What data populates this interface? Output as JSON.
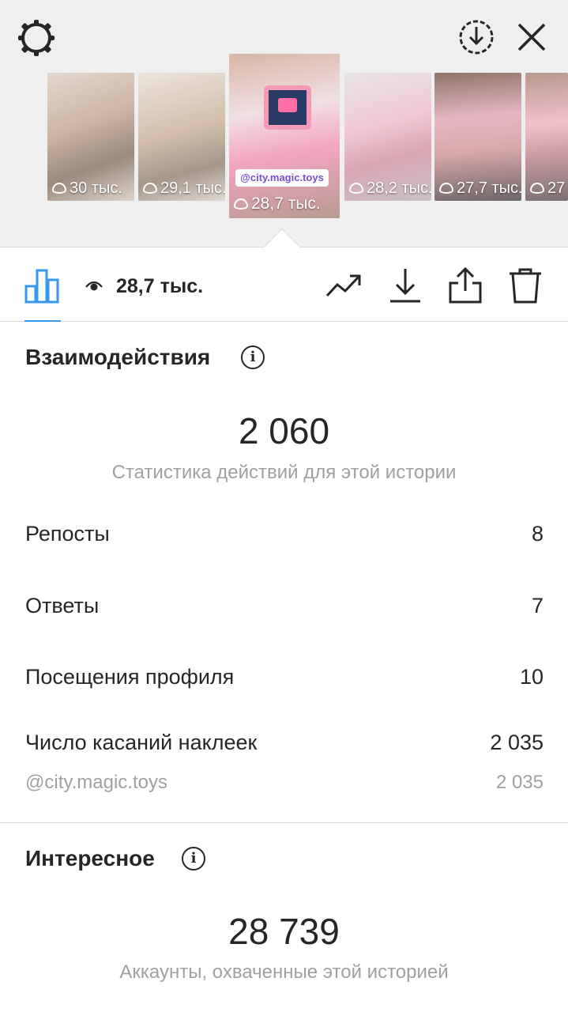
{
  "header": {
    "icons": [
      "settings-icon",
      "download-circle-icon",
      "close-icon"
    ]
  },
  "stories": [
    {
      "views": "30 тыс."
    },
    {
      "views": "29,1 тыс."
    },
    {
      "views": "28,7 тыс.",
      "selected": true,
      "sticker": "@city.magic.toys"
    },
    {
      "views": "28,2 тыс."
    },
    {
      "views": "27,7 тыс."
    },
    {
      "views": "27"
    }
  ],
  "toolbar": {
    "views_total": "28,7 тыс.",
    "icons": [
      "bar-chart-icon",
      "eye-icon",
      "trend-icon",
      "download-icon",
      "share-icon",
      "trash-icon"
    ]
  },
  "interactions": {
    "title": "Взаимодействия",
    "total": "2 060",
    "subtitle": "Статистика действий для этой истории",
    "rows": [
      {
        "label": "Репосты",
        "value": "8"
      },
      {
        "label": "Ответы",
        "value": "7"
      },
      {
        "label": "Посещения профиля",
        "value": "10"
      },
      {
        "label": "Число касаний наклеек",
        "value": "2 035"
      }
    ],
    "sticker_row": {
      "label": "@city.magic.toys",
      "value": "2 035"
    }
  },
  "discovery": {
    "title": "Интересное",
    "total": "28 739",
    "subtitle": "Аккаунты, охваченные этой историей"
  },
  "colors": {
    "accent": "#3897f0",
    "text": "#262626",
    "muted": "#a0a0a0",
    "background_top": "#efefef"
  }
}
